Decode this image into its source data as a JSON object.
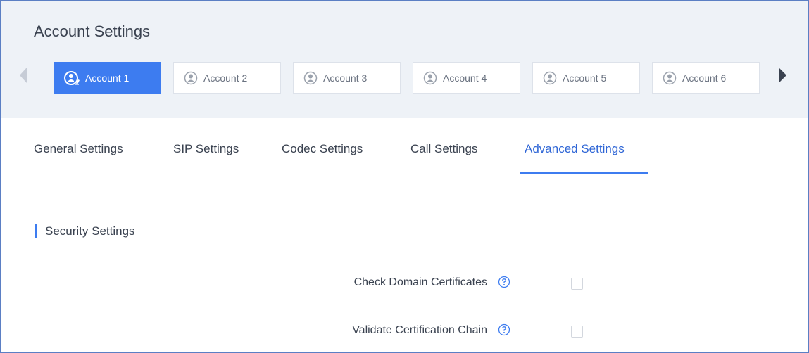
{
  "page_title": "Account Settings",
  "accounts": [
    {
      "label": "Account 1",
      "active": true
    },
    {
      "label": "Account 2",
      "active": false
    },
    {
      "label": "Account 3",
      "active": false
    },
    {
      "label": "Account 4",
      "active": false
    },
    {
      "label": "Account 5",
      "active": false
    },
    {
      "label": "Account 6",
      "active": false
    }
  ],
  "subtabs": [
    {
      "label": "General Settings"
    },
    {
      "label": "SIP Settings"
    },
    {
      "label": "Codec Settings"
    },
    {
      "label": "Call Settings"
    },
    {
      "label": "Advanced Settings",
      "active": true
    }
  ],
  "section": {
    "title": "Security Settings",
    "fields": [
      {
        "label": "Check Domain Certificates",
        "checked": false
      },
      {
        "label": "Validate Certification Chain",
        "checked": false
      }
    ]
  },
  "colors": {
    "accent": "#3d7cf0",
    "header_bg": "#eef2f7",
    "text": "#3a4250"
  },
  "icons": {
    "account_active": "account-edit-icon",
    "account": "account-icon",
    "help": "help-circle-icon",
    "prev": "arrow-left-icon",
    "next": "arrow-right-icon"
  }
}
